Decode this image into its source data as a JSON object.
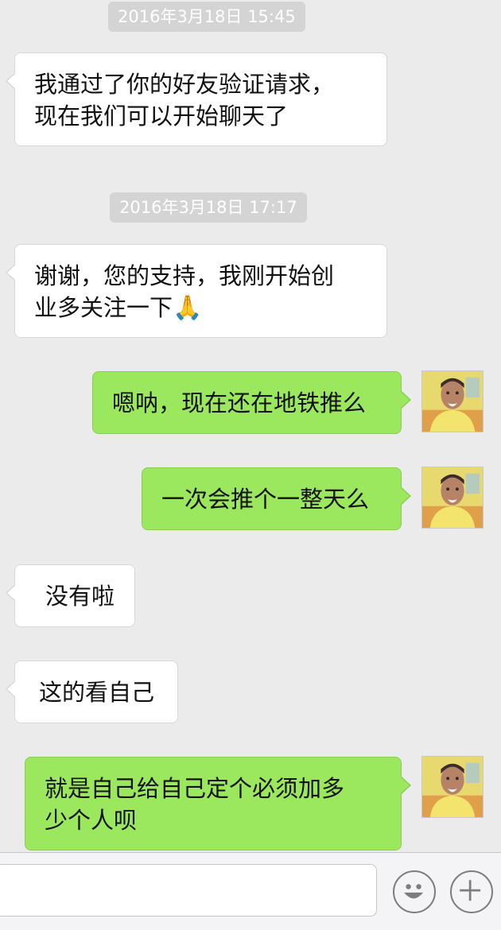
{
  "conversation": {
    "timestamps": [
      "2016年3月18日 15:45",
      "2016年3月18日 17:17"
    ],
    "messages": [
      {
        "from": "contact",
        "lines": [
          "我通过了你的好友验证请求，",
          "现在我们可以开始聊天了"
        ]
      },
      {
        "from": "contact",
        "lines": [
          "谢谢，您的支持，我刚开始创",
          "业多关注一下"
        ],
        "emoji": "🙏"
      },
      {
        "from": "me",
        "lines": [
          "嗯呐，现在还在地铁推么"
        ]
      },
      {
        "from": "me",
        "lines": [
          "一次会推个一整天么"
        ]
      },
      {
        "from": "contact",
        "lines": [
          "没有啦"
        ]
      },
      {
        "from": "contact",
        "lines": [
          "这的看自己"
        ]
      },
      {
        "from": "me",
        "lines": [
          "就是自己给自己定个必须加多",
          "少个人呗"
        ]
      }
    ]
  },
  "input_bar": {
    "text_value": "",
    "emoji_button_icon": "smiley-face-icon",
    "more_button_icon": "plus-icon"
  },
  "colors": {
    "background": "#ebebeb",
    "incoming_bubble": "#ffffff",
    "outgoing_bubble": "#9be85e",
    "timestamp_pill": "#d4d4d4"
  }
}
